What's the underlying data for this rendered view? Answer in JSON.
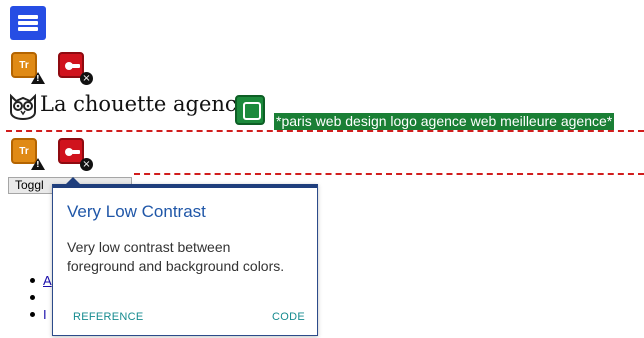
{
  "brand": {
    "name": "La chouette agence",
    "alt_text": "*paris web design logo agence web meilleure agence*"
  },
  "icons": {
    "css3": "css3-badge-icon",
    "alert_label": "Tr",
    "error": "contrast-error-icon",
    "link": "linked-image-icon",
    "owl": "owl-logo-icon"
  },
  "toggle_button": {
    "label": "Toggl"
  },
  "tooltip": {
    "title": "Very Low Contrast",
    "body": "Very low contrast between foreground and background colors.",
    "reference_label": "REFERENCE",
    "code_label": "CODE"
  },
  "list": {
    "items": [
      "A",
      "",
      "I"
    ]
  },
  "colors": {
    "accent_blue": "#2057a8",
    "alt_green": "#1a7f35",
    "error_red": "#d0131d",
    "alert_orange": "#e08a15",
    "dash_red": "#d11d1d",
    "link_teal": "#168b8f"
  }
}
